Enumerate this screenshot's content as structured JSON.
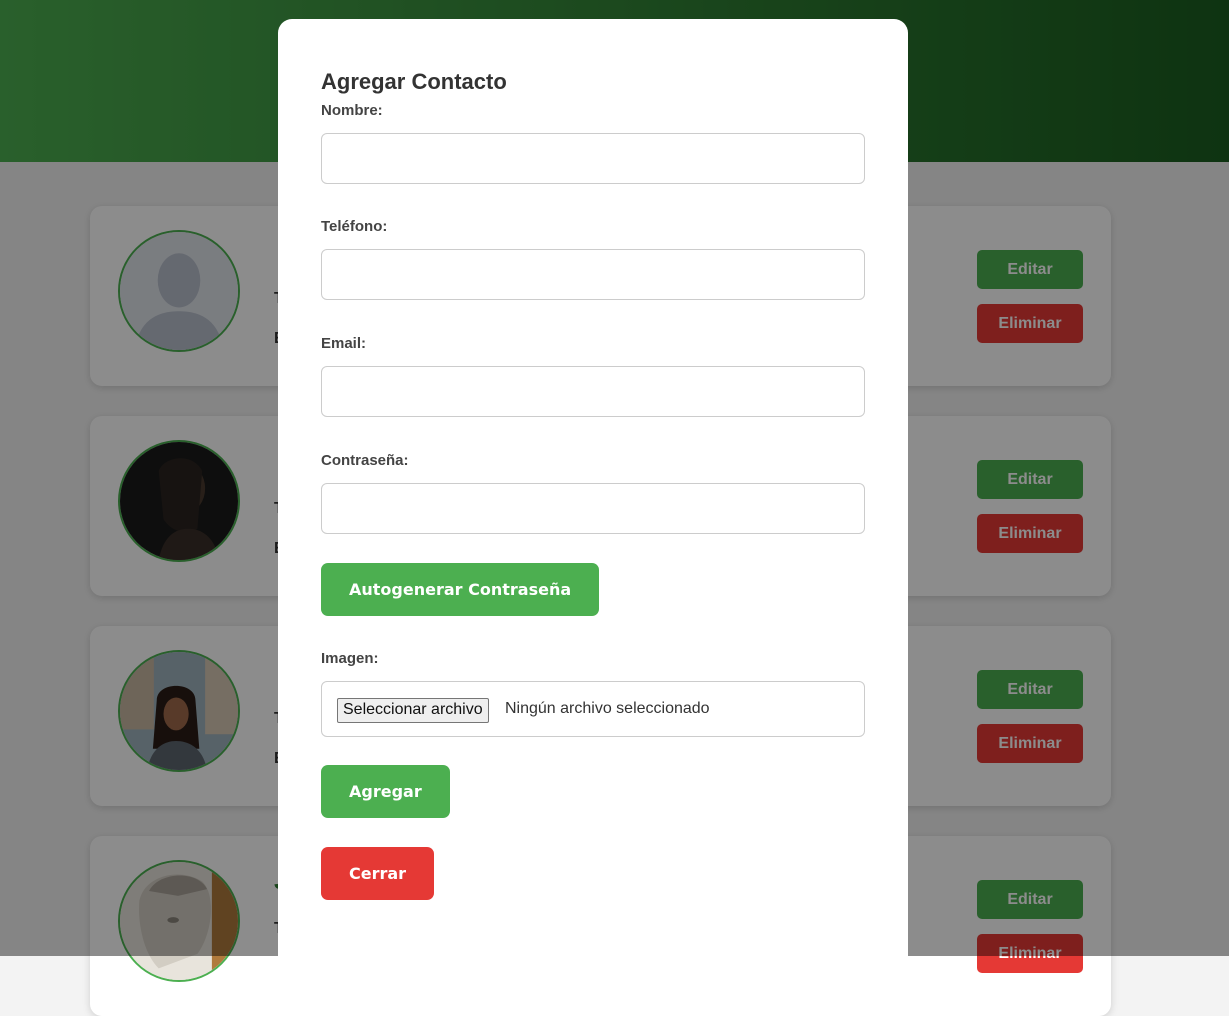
{
  "contacts": [
    {
      "name": "",
      "phone": "T",
      "email": "E",
      "avatar": "default-silhouette",
      "edit_label": "Editar",
      "delete_label": "Eliminar"
    },
    {
      "name": "",
      "phone": "T",
      "email": "E",
      "avatar": "woman-profile-dark",
      "edit_label": "Editar",
      "delete_label": "Eliminar"
    },
    {
      "name": "",
      "phone": "T",
      "email": "E",
      "avatar": "woman-smiling-street",
      "edit_label": "Editar",
      "delete_label": "Eliminar"
    },
    {
      "name": "J",
      "phone": "T",
      "email": "",
      "avatar": "statue-head",
      "edit_label": "Editar",
      "delete_label": "Eliminar"
    }
  ],
  "modal": {
    "title": "Agregar Contacto",
    "fields": {
      "name_label": "Nombre:",
      "name_value": "",
      "phone_label": "Teléfono:",
      "phone_value": "",
      "email_label": "Email:",
      "email_value": "",
      "password_label": "Contraseña:",
      "password_value": ""
    },
    "autogenerate_label": "Autogenerar Contraseña",
    "image_label": "Imagen:",
    "file_button_label": "Seleccionar archivo",
    "file_status": "Ningún archivo seleccionado",
    "submit_label": "Agregar",
    "close_label": "Cerrar"
  },
  "colors": {
    "primary_green": "#4caf50",
    "header_dark_green": "#1b5e20",
    "danger_red": "#e53935"
  }
}
